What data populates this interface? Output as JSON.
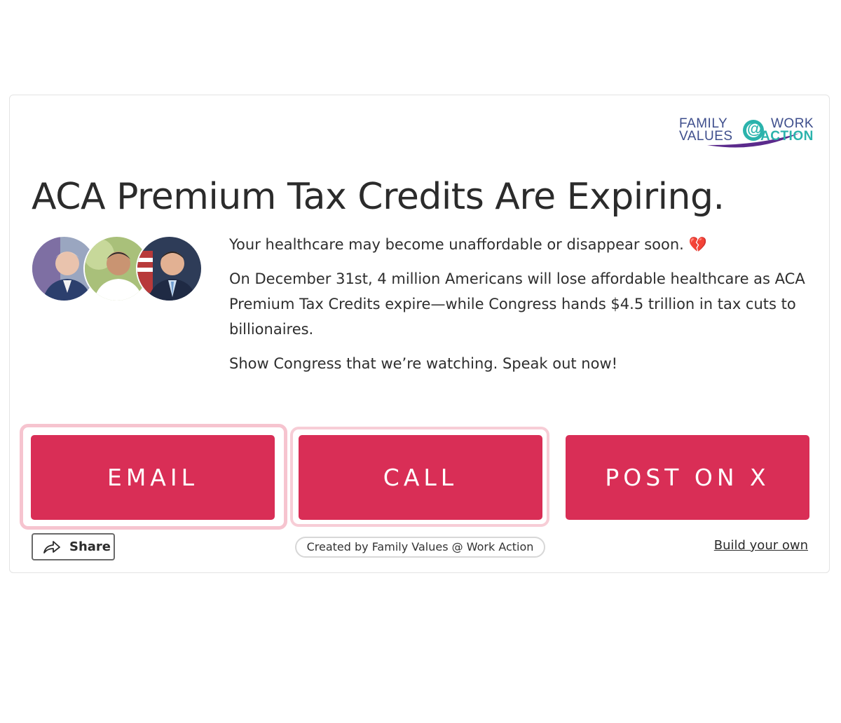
{
  "logo": {
    "line1_left": "FAMILY",
    "line2_left": "VALUES",
    "symbol": "@",
    "line1_right": "WORK",
    "line2_right": "ACTION",
    "colors": {
      "navy": "#3e4e8c",
      "teal": "#2bb3ac",
      "purple": "#5b2a8c"
    }
  },
  "headline": "ACA Premium Tax Credits Are Expiring.",
  "avatars": [
    {
      "icon": "person-photo-avatar",
      "bg": "#8a9ab8"
    },
    {
      "icon": "person-photo-avatar",
      "bg": "#9bb36a"
    },
    {
      "icon": "person-photo-avatar",
      "bg": "#2f3f5e"
    }
  ],
  "body": {
    "p1": "Your healthcare may become unaffordable or disappear soon.",
    "p1_emoji": "💔",
    "p2": "On December 31st, 4 million Americans will lose affordable healthcare as ACA Premium Tax Credits expire—while Congress hands $4.5 trillion in tax cuts to billionaires.",
    "p3": "Show Congress that we’re watching. Speak out now!"
  },
  "actions": {
    "email": "EMAIL",
    "call": "CALL",
    "post": "POST ON X",
    "button_color": "#d92e56"
  },
  "footer": {
    "share_label": "Share",
    "share_icon": "share-arrow-icon",
    "creator": "Created by Family Values @ Work Action",
    "build_link": "Build your own"
  }
}
